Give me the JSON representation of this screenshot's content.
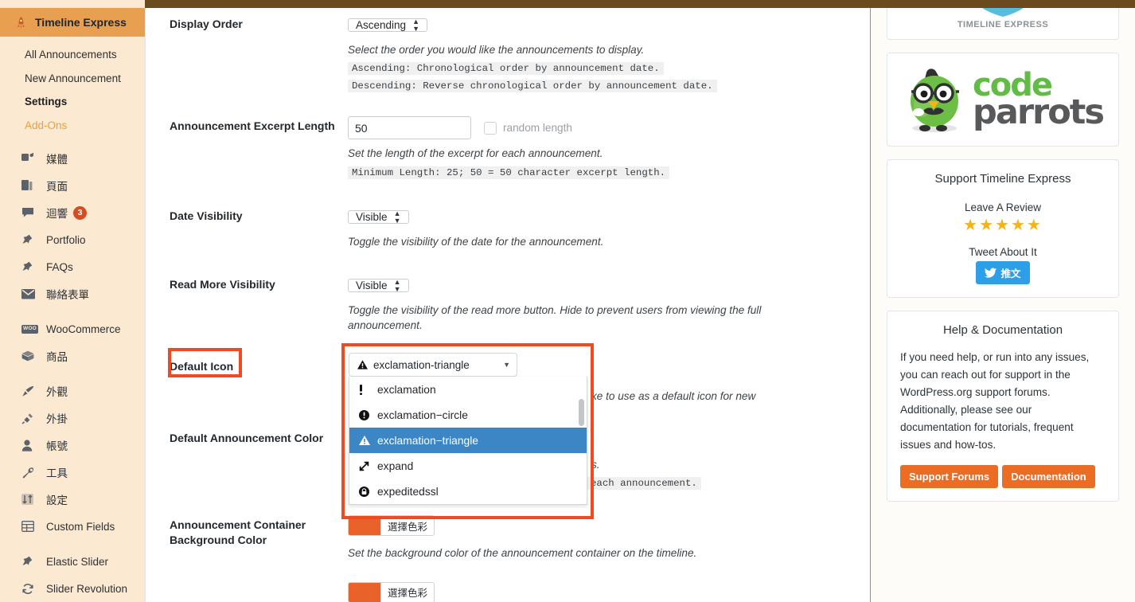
{
  "sidebar": {
    "current": {
      "label": "Timeline Express",
      "icon": "rocket-icon"
    },
    "submenu": [
      {
        "label": "All Announcements",
        "state": "normal"
      },
      {
        "label": "New Announcement",
        "state": "normal"
      },
      {
        "label": "Settings",
        "state": "active"
      },
      {
        "label": "Add-Ons",
        "state": "accent"
      }
    ],
    "items": [
      {
        "label": "媒體",
        "icon": "media-icon",
        "badge": null
      },
      {
        "label": "頁面",
        "icon": "pages-icon",
        "badge": null
      },
      {
        "label": "迴響",
        "icon": "comments-icon",
        "badge": "3"
      },
      {
        "label": "Portfolio",
        "icon": "pin-icon",
        "badge": null
      },
      {
        "label": "FAQs",
        "icon": "pin-icon",
        "badge": null
      },
      {
        "label": "聯絡表單",
        "icon": "envelope-icon",
        "badge": null
      },
      {
        "label": "WooCommerce",
        "icon": "woo-icon",
        "badge": null
      },
      {
        "label": "商品",
        "icon": "box-icon",
        "badge": null
      },
      {
        "label": "外觀",
        "icon": "brush-icon",
        "badge": null
      },
      {
        "label": "外掛",
        "icon": "plug-icon",
        "badge": null
      },
      {
        "label": "帳號",
        "icon": "user-icon",
        "badge": null
      },
      {
        "label": "工具",
        "icon": "wrench-icon",
        "badge": null
      },
      {
        "label": "設定",
        "icon": "sliders-icon",
        "badge": null
      },
      {
        "label": "Custom Fields",
        "icon": "table-icon",
        "badge": null
      },
      {
        "label": "Elastic Slider",
        "icon": "pin-icon",
        "badge": null
      },
      {
        "label": "Slider Revolution",
        "icon": "refresh-icon",
        "badge": null
      }
    ]
  },
  "settings": {
    "display_order": {
      "label": "Display Order",
      "value": "Ascending",
      "description": "Select the order you would like the announcements to display.",
      "note1": "Ascending: Chronological order by announcement date.",
      "note2": "Descending: Reverse chronological order by announcement date."
    },
    "excerpt_length": {
      "label": "Announcement Excerpt Length",
      "value": "50",
      "checkbox_label": "random length",
      "description": "Set the length of the excerpt for each announcement.",
      "note": "Minimum Length: 25; 50 = 50 character excerpt length."
    },
    "date_visibility": {
      "label": "Date Visibility",
      "value": "Visible",
      "description": "Toggle the visibility of the date for the announcement."
    },
    "read_more_visibility": {
      "label": "Read More Visibility",
      "value": "Visible",
      "description": "Toggle the visibility of the read more button. Hide to prevent users from viewing the full announcement."
    },
    "default_icon": {
      "label": "Default Icon",
      "value": "exclamation-triangle",
      "description_visible_fragment": "ke to use as a default icon for new",
      "options": [
        {
          "label": "exclamation",
          "icon": "exclamation-icon",
          "selected": false
        },
        {
          "label": "exclamation−circle",
          "icon": "exclamation-circle-icon",
          "selected": false
        },
        {
          "label": "exclamation−triangle",
          "icon": "exclamation-triangle-icon",
          "selected": true
        },
        {
          "label": "expand",
          "icon": "expand-icon",
          "selected": false
        },
        {
          "label": "expeditedssl",
          "icon": "lock-icon",
          "selected": false
        }
      ]
    },
    "default_announcement_color": {
      "label": "Default Announcement Color",
      "occluded_fragment_1": "s.",
      "occluded_fragment_2": "each announcement."
    },
    "container_bg_color": {
      "label": "Announcement Container Background Color",
      "button_label": "選擇色彩",
      "swatch": "#e8622a",
      "description": "Set the background color of the announcement container on the timeline."
    },
    "next_color_field": {
      "button_label": "選擇色彩",
      "swatch": "#e8622a"
    }
  },
  "rightbar": {
    "logo_widget": {
      "caption": "TIMELINE EXPRESS"
    },
    "codeparrots": {
      "word1": "code",
      "word2": "parrots"
    },
    "support": {
      "title": "Support Timeline Express",
      "review_label": "Leave A Review",
      "stars": "★★★★★",
      "tweet_label": "Tweet About It",
      "tweet_button": "推文"
    },
    "help": {
      "title": "Help & Documentation",
      "body": "If you need help, or run into any issues, you can reach out for support in the WordPress.org support forums. Additionally, please see our documentation for tutorials, frequent issues and how-tos.",
      "btn_support": "Support Forums",
      "btn_docs": "Documentation"
    }
  },
  "colors": {
    "adminbar": "#6b4a1e",
    "sidebar_bg": "#fbe9d2",
    "menu_active": "#e8a050",
    "accent_orange": "#e8a040",
    "highlight_red": "#f04a23",
    "dropdown_selected": "#3d86c6",
    "button_orange": "#ec6c24",
    "twitter_blue": "#2d9fe8",
    "star_yellow": "#f5b317"
  }
}
